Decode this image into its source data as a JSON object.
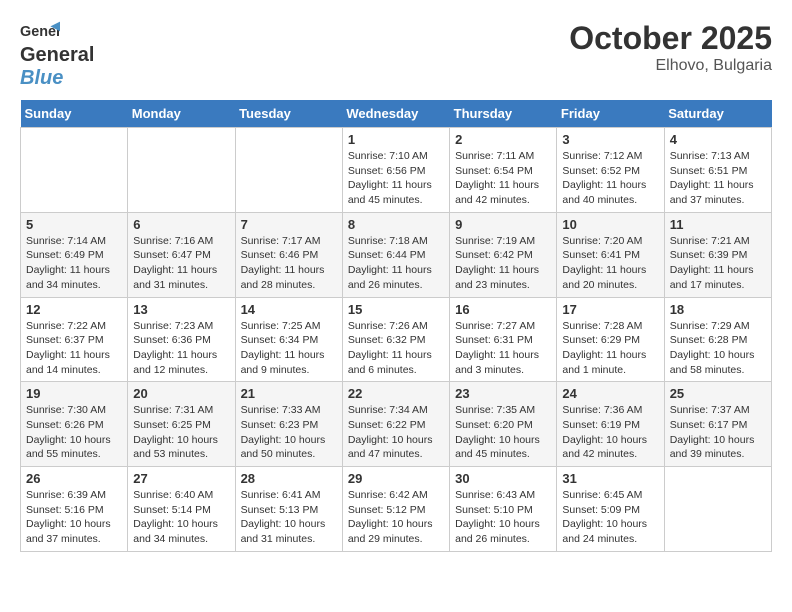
{
  "header": {
    "logo_general": "General",
    "logo_blue": "Blue",
    "month": "October 2025",
    "location": "Elhovo, Bulgaria"
  },
  "weekdays": [
    "Sunday",
    "Monday",
    "Tuesday",
    "Wednesday",
    "Thursday",
    "Friday",
    "Saturday"
  ],
  "rows": [
    [
      {
        "day": "",
        "info": ""
      },
      {
        "day": "",
        "info": ""
      },
      {
        "day": "",
        "info": ""
      },
      {
        "day": "1",
        "info": "Sunrise: 7:10 AM\nSunset: 6:56 PM\nDaylight: 11 hours and 45 minutes."
      },
      {
        "day": "2",
        "info": "Sunrise: 7:11 AM\nSunset: 6:54 PM\nDaylight: 11 hours and 42 minutes."
      },
      {
        "day": "3",
        "info": "Sunrise: 7:12 AM\nSunset: 6:52 PM\nDaylight: 11 hours and 40 minutes."
      },
      {
        "day": "4",
        "info": "Sunrise: 7:13 AM\nSunset: 6:51 PM\nDaylight: 11 hours and 37 minutes."
      }
    ],
    [
      {
        "day": "5",
        "info": "Sunrise: 7:14 AM\nSunset: 6:49 PM\nDaylight: 11 hours and 34 minutes."
      },
      {
        "day": "6",
        "info": "Sunrise: 7:16 AM\nSunset: 6:47 PM\nDaylight: 11 hours and 31 minutes."
      },
      {
        "day": "7",
        "info": "Sunrise: 7:17 AM\nSunset: 6:46 PM\nDaylight: 11 hours and 28 minutes."
      },
      {
        "day": "8",
        "info": "Sunrise: 7:18 AM\nSunset: 6:44 PM\nDaylight: 11 hours and 26 minutes."
      },
      {
        "day": "9",
        "info": "Sunrise: 7:19 AM\nSunset: 6:42 PM\nDaylight: 11 hours and 23 minutes."
      },
      {
        "day": "10",
        "info": "Sunrise: 7:20 AM\nSunset: 6:41 PM\nDaylight: 11 hours and 20 minutes."
      },
      {
        "day": "11",
        "info": "Sunrise: 7:21 AM\nSunset: 6:39 PM\nDaylight: 11 hours and 17 minutes."
      }
    ],
    [
      {
        "day": "12",
        "info": "Sunrise: 7:22 AM\nSunset: 6:37 PM\nDaylight: 11 hours and 14 minutes."
      },
      {
        "day": "13",
        "info": "Sunrise: 7:23 AM\nSunset: 6:36 PM\nDaylight: 11 hours and 12 minutes."
      },
      {
        "day": "14",
        "info": "Sunrise: 7:25 AM\nSunset: 6:34 PM\nDaylight: 11 hours and 9 minutes."
      },
      {
        "day": "15",
        "info": "Sunrise: 7:26 AM\nSunset: 6:32 PM\nDaylight: 11 hours and 6 minutes."
      },
      {
        "day": "16",
        "info": "Sunrise: 7:27 AM\nSunset: 6:31 PM\nDaylight: 11 hours and 3 minutes."
      },
      {
        "day": "17",
        "info": "Sunrise: 7:28 AM\nSunset: 6:29 PM\nDaylight: 11 hours and 1 minute."
      },
      {
        "day": "18",
        "info": "Sunrise: 7:29 AM\nSunset: 6:28 PM\nDaylight: 10 hours and 58 minutes."
      }
    ],
    [
      {
        "day": "19",
        "info": "Sunrise: 7:30 AM\nSunset: 6:26 PM\nDaylight: 10 hours and 55 minutes."
      },
      {
        "day": "20",
        "info": "Sunrise: 7:31 AM\nSunset: 6:25 PM\nDaylight: 10 hours and 53 minutes."
      },
      {
        "day": "21",
        "info": "Sunrise: 7:33 AM\nSunset: 6:23 PM\nDaylight: 10 hours and 50 minutes."
      },
      {
        "day": "22",
        "info": "Sunrise: 7:34 AM\nSunset: 6:22 PM\nDaylight: 10 hours and 47 minutes."
      },
      {
        "day": "23",
        "info": "Sunrise: 7:35 AM\nSunset: 6:20 PM\nDaylight: 10 hours and 45 minutes."
      },
      {
        "day": "24",
        "info": "Sunrise: 7:36 AM\nSunset: 6:19 PM\nDaylight: 10 hours and 42 minutes."
      },
      {
        "day": "25",
        "info": "Sunrise: 7:37 AM\nSunset: 6:17 PM\nDaylight: 10 hours and 39 minutes."
      }
    ],
    [
      {
        "day": "26",
        "info": "Sunrise: 6:39 AM\nSunset: 5:16 PM\nDaylight: 10 hours and 37 minutes."
      },
      {
        "day": "27",
        "info": "Sunrise: 6:40 AM\nSunset: 5:14 PM\nDaylight: 10 hours and 34 minutes."
      },
      {
        "day": "28",
        "info": "Sunrise: 6:41 AM\nSunset: 5:13 PM\nDaylight: 10 hours and 31 minutes."
      },
      {
        "day": "29",
        "info": "Sunrise: 6:42 AM\nSunset: 5:12 PM\nDaylight: 10 hours and 29 minutes."
      },
      {
        "day": "30",
        "info": "Sunrise: 6:43 AM\nSunset: 5:10 PM\nDaylight: 10 hours and 26 minutes."
      },
      {
        "day": "31",
        "info": "Sunrise: 6:45 AM\nSunset: 5:09 PM\nDaylight: 10 hours and 24 minutes."
      },
      {
        "day": "",
        "info": ""
      }
    ]
  ]
}
